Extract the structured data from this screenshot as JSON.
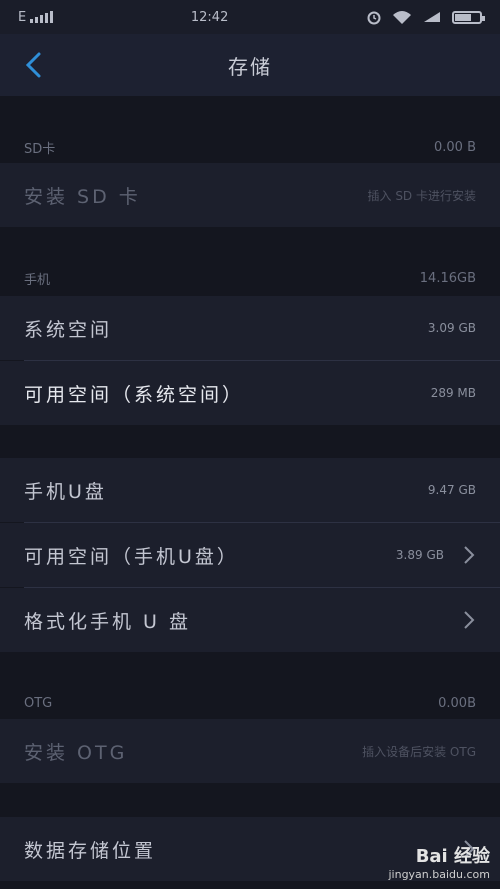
{
  "status": {
    "carrier": "E",
    "time": "12:42"
  },
  "header": {
    "title": "存储",
    "back_icon": "chevron-left-icon"
  },
  "sd": {
    "section_label": "SD卡",
    "section_value": "0.00 B",
    "install_label": "安装 SD 卡",
    "install_hint": "插入 SD 卡进行安装"
  },
  "phone": {
    "section_label": "手机",
    "section_value": "14.16GB",
    "system_label": "系统空间",
    "system_value": "3.09 GB",
    "available_label": "可用空间（系统空间）",
    "available_value": "289 MB"
  },
  "udisk": {
    "label": "手机U盘",
    "value": "9.47 GB",
    "available_label": "可用空间（手机U盘）",
    "available_value": "3.89 GB",
    "format_label": "格式化手机 U 盘"
  },
  "otg": {
    "section_label": "OTG",
    "section_value": "0.00B",
    "install_label": "安装 OTG",
    "install_hint": "插入设备后安装 OTG"
  },
  "storage": {
    "location_label": "数据存储位置"
  },
  "watermark": {
    "brand": "Bai 经验",
    "url": "jingyan.baidu.com"
  },
  "colors": {
    "background": "#14161f",
    "row": "#1c1f2c",
    "accent": "#2f8fd8"
  }
}
